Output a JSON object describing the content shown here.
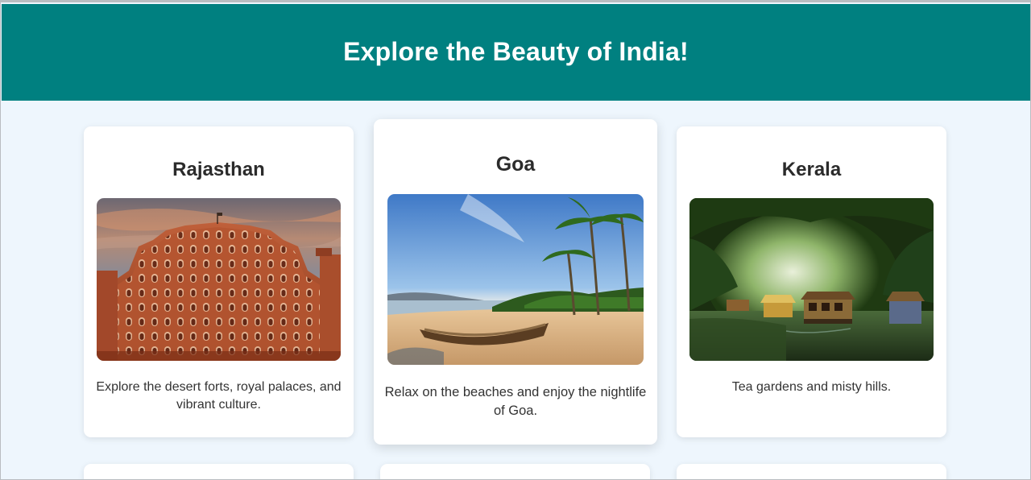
{
  "header": {
    "title": "Explore the Beauty of India!"
  },
  "colors": {
    "banner": "#008080",
    "page_bg": "#eef6fd",
    "card_bg": "#ffffff"
  },
  "destinations": [
    {
      "name": "Rajasthan",
      "description": "Explore the desert forts, royal palaces, and vibrant culture.",
      "image": "hawa-mahal-palace-photo"
    },
    {
      "name": "Goa",
      "description": "Relax on the beaches and enjoy the nightlife of Goa.",
      "image": "beach-boat-palms-photo"
    },
    {
      "name": "Kerala",
      "description": "Tea gardens and misty hills.",
      "image": "backwater-houseboats-photo"
    }
  ]
}
